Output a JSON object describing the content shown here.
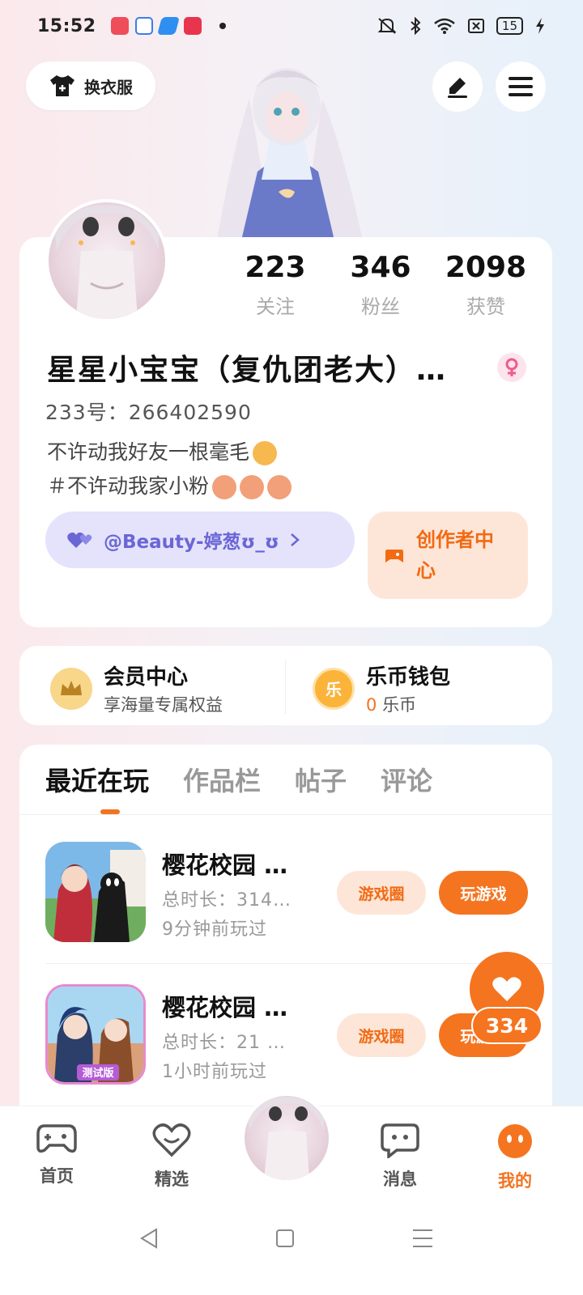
{
  "status_bar": {
    "time": "15:52",
    "battery": "15"
  },
  "top": {
    "dress_button": "换衣服"
  },
  "profile": {
    "stats": [
      {
        "value": "223",
        "label": "关注"
      },
      {
        "value": "346",
        "label": "粉丝"
      },
      {
        "value": "2098",
        "label": "获赞"
      }
    ],
    "nickname": "星星小宝宝（复仇团老大）…",
    "id_line": "233号：266402590",
    "bio_line1": "不许动我好友一根毫毛",
    "bio_line2": "＃不许动我家小粉",
    "fan_tag": "@Beauty-婷葱ʊ_ʊ",
    "creator_center": "创作者中心"
  },
  "vip": {
    "member_title": "会员中心",
    "member_sub": "享海量专属权益",
    "wallet_title": "乐币钱包",
    "wallet_amount": "0",
    "wallet_unit": "乐币",
    "coin_glyph": "乐"
  },
  "tabs": [
    "最近在玩",
    "作品栏",
    "帖子",
    "评论"
  ],
  "games": [
    {
      "title": "樱花校园 …",
      "duration": "总时长：314…",
      "last_played": "9分钟前玩过",
      "circle_btn": "游戏圈",
      "play_btn": "玩游戏"
    },
    {
      "title": "樱花校园 …",
      "duration": "总时长：21 …",
      "last_played": "1小时前玩过",
      "circle_btn": "游戏圈",
      "play_btn": "玩游戏",
      "badge": "测试版"
    }
  ],
  "like_count": "334",
  "bottom_nav": [
    {
      "label": "首页",
      "icon": "gamepad-icon"
    },
    {
      "label": "精选",
      "icon": "heart-outline-icon"
    },
    {
      "label": "消息",
      "icon": "chat-icon"
    },
    {
      "label": "我的",
      "icon": "face-icon"
    }
  ],
  "colors": {
    "accent": "#f5741f",
    "fan_pill_bg": "#e4e3fb",
    "fan_pill_text": "#6b66d6"
  }
}
